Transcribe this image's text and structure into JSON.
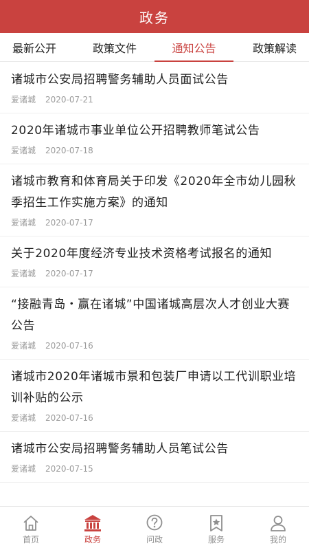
{
  "header": {
    "title": "政务"
  },
  "tabs": [
    {
      "label": "最新公开"
    },
    {
      "label": "政策文件"
    },
    {
      "label": "通知公告"
    },
    {
      "label": "政策解读"
    }
  ],
  "list": [
    {
      "title": "诸城市公安局招聘警务辅助人员面试公告",
      "source": "爱诸城",
      "date": "2020-07-21"
    },
    {
      "title": "2020年诸城市事业单位公开招聘教师笔试公告",
      "source": "爱诸城",
      "date": "2020-07-18"
    },
    {
      "title": "诸城市教育和体育局关于印发《2020年全市幼儿园秋季招生工作实施方案》的通知",
      "source": "爱诸城",
      "date": "2020-07-17"
    },
    {
      "title": "关于2020年度经济专业技术资格考试报名的通知",
      "source": "爱诸城",
      "date": "2020-07-17"
    },
    {
      "title": "“接融青岛・赢在诸城”中国诸城高层次人才创业大赛公告",
      "source": "爱诸城",
      "date": "2020-07-16"
    },
    {
      "title": "诸城市2020年诸城市景和包装厂申请以工代训职业培训补贴的公示",
      "source": "爱诸城",
      "date": "2020-07-16"
    },
    {
      "title": "诸城市公安局招聘警务辅助人员笔试公告",
      "source": "爱诸城",
      "date": "2020-07-15"
    }
  ],
  "bottom_nav": [
    {
      "label": "首页",
      "icon": "home-icon"
    },
    {
      "label": "政务",
      "icon": "government-building-icon"
    },
    {
      "label": "问政",
      "icon": "question-bubble-icon"
    },
    {
      "label": "服务",
      "icon": "star-bookmark-icon"
    },
    {
      "label": "我的",
      "icon": "user-icon"
    }
  ],
  "colors": {
    "accent": "#c9423f",
    "inactive": "#8f8f8f",
    "meta_text": "#9a9a9a"
  }
}
